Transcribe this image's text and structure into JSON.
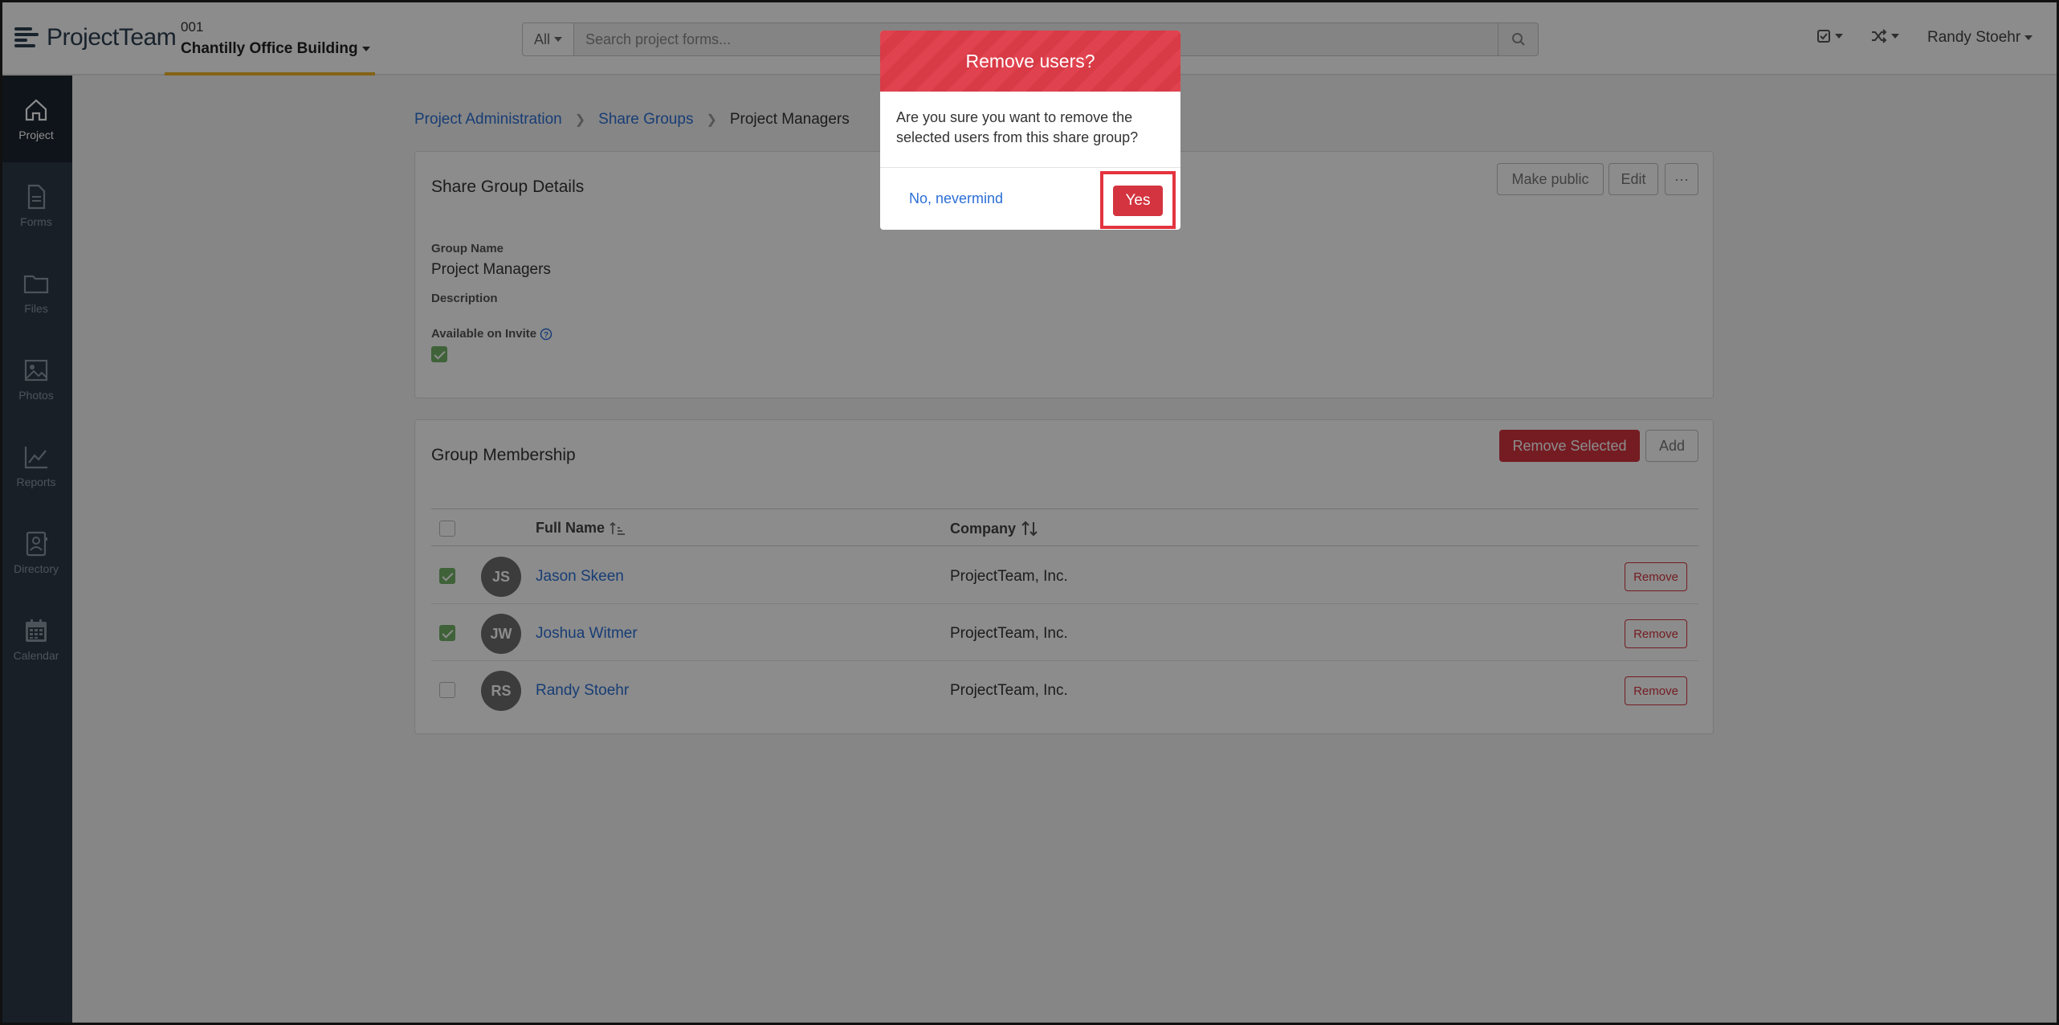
{
  "app": {
    "brand_light": "Project",
    "brand_bold": "Team"
  },
  "project": {
    "number": "001",
    "name": "Chantilly Office Building"
  },
  "search": {
    "scope": "All",
    "placeholder": "Search project forms..."
  },
  "user": {
    "name": "Randy Stoehr"
  },
  "sidebar": {
    "items": [
      {
        "label": "Project",
        "icon": "home-icon",
        "active": true
      },
      {
        "label": "Forms",
        "icon": "document-icon",
        "active": false
      },
      {
        "label": "Files",
        "icon": "folder-icon",
        "active": false
      },
      {
        "label": "Photos",
        "icon": "image-icon",
        "active": false
      },
      {
        "label": "Reports",
        "icon": "chart-line-icon",
        "active": false
      },
      {
        "label": "Directory",
        "icon": "address-book-icon",
        "active": false
      },
      {
        "label": "Calendar",
        "icon": "calendar-icon",
        "active": false
      }
    ]
  },
  "breadcrumb": {
    "items": [
      "Project Administration",
      "Share Groups"
    ],
    "current": "Project Managers"
  },
  "details": {
    "title": "Share Group Details",
    "buttons": {
      "make_public": "Make public",
      "edit": "Edit",
      "more": "···"
    },
    "group_name_label": "Group Name",
    "group_name_value": "Project Managers",
    "description_label": "Description",
    "available_label": "Available on Invite",
    "available_checked": true
  },
  "membership": {
    "title": "Group Membership",
    "remove_selected_label": "Remove Selected",
    "add_label": "Add",
    "columns": {
      "full_name": "Full Name",
      "company": "Company"
    },
    "rows": [
      {
        "initials": "JS",
        "name": "Jason Skeen",
        "company": "ProjectTeam, Inc.",
        "checked": true,
        "action": "Remove"
      },
      {
        "initials": "JW",
        "name": "Joshua Witmer",
        "company": "ProjectTeam, Inc.",
        "checked": true,
        "action": "Remove"
      },
      {
        "initials": "RS",
        "name": "Randy Stoehr",
        "company": "ProjectTeam, Inc.",
        "checked": false,
        "action": "Remove"
      }
    ]
  },
  "modal": {
    "title": "Remove users?",
    "message": "Are you sure you want to remove the selected users from this share group?",
    "no_label": "No, nevermind",
    "yes_label": "Yes"
  },
  "colors": {
    "accent_blue": "#2c6fd6",
    "danger": "#d3343f",
    "sidebar": "#2c3a47",
    "project_underline": "#f0b429",
    "check_green": "#74b266"
  }
}
